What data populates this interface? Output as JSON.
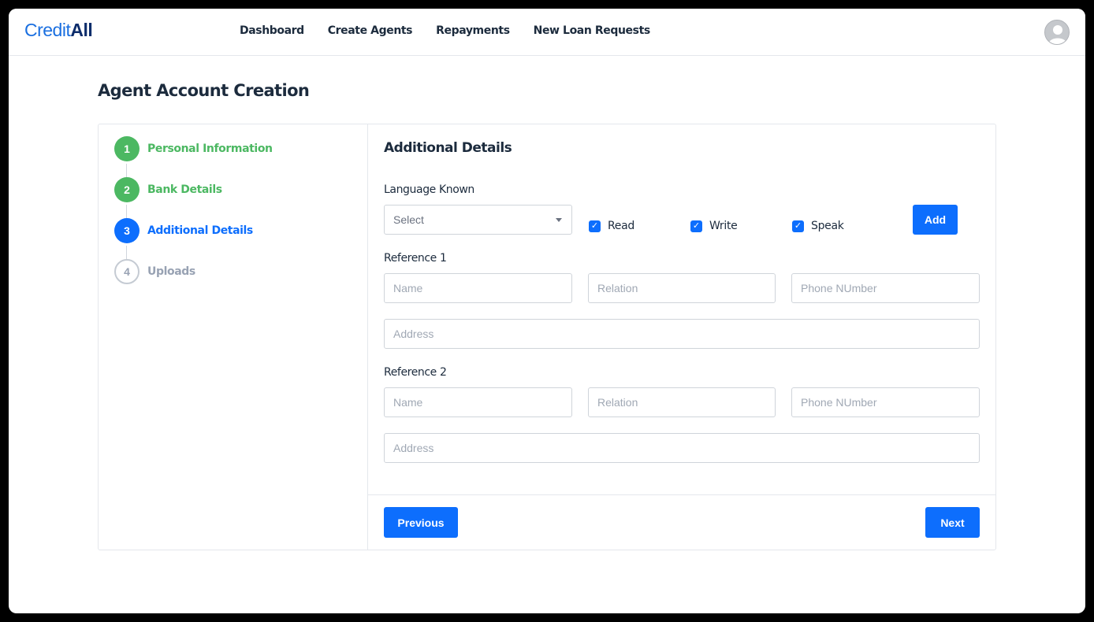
{
  "brand": {
    "part1": "Credit",
    "part2": "All"
  },
  "nav": [
    "Dashboard",
    "Create Agents",
    "Repayments",
    "New Loan Requests"
  ],
  "page_title": "Agent Account Creation",
  "steps": [
    {
      "number": "1",
      "label": "Personal Information",
      "state": "done"
    },
    {
      "number": "2",
      "label": "Bank Details",
      "state": "done"
    },
    {
      "number": "3",
      "label": "Additional Details",
      "state": "active"
    },
    {
      "number": "4",
      "label": "Uploads",
      "state": "todo"
    }
  ],
  "colors": {
    "primary": "#0d6efd",
    "success": "#4cb862",
    "muted": "#98a2b3",
    "text": "#1c2b3d"
  },
  "form": {
    "title": "Additional Details",
    "language": {
      "label": "Language Known",
      "select_value": "Select",
      "checks": [
        {
          "label": "Read",
          "checked": true
        },
        {
          "label": "Write",
          "checked": true
        },
        {
          "label": "Speak",
          "checked": true
        }
      ],
      "add_label": "Add"
    },
    "ref1": {
      "label": "Reference 1",
      "name_ph": "Name",
      "relation_ph": "Relation",
      "phone_ph": "Phone NUmber",
      "address_ph": "Address"
    },
    "ref2": {
      "label": "Reference 2",
      "name_ph": "Name",
      "relation_ph": "Relation",
      "phone_ph": "Phone NUmber",
      "address_ph": "Address"
    },
    "previous_label": "Previous",
    "next_label": "Next"
  }
}
